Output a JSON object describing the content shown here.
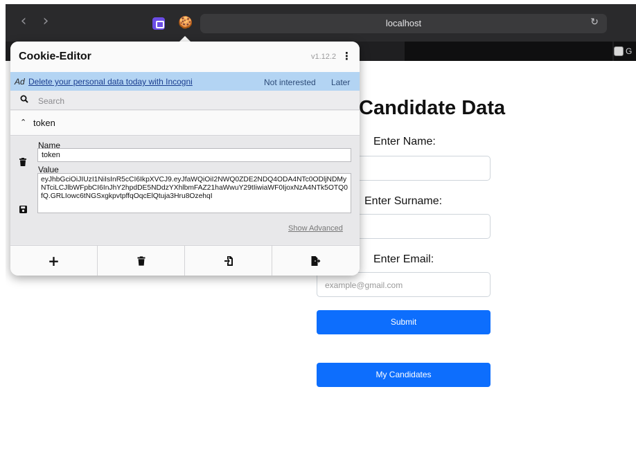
{
  "browser": {
    "url": "localhost",
    "tab_right_label": "G"
  },
  "page": {
    "title": "Candidate Data",
    "name_label": "Enter Name:",
    "surname_label": "Enter Surname:",
    "email_label": "Enter Email:",
    "email_placeholder": "example@gmail.com",
    "submit_label": "Submit",
    "my_candidates_label": "My Candidates"
  },
  "popup": {
    "title": "Cookie-Editor",
    "version": "v1.12.2",
    "ad": {
      "tag": "Ad",
      "link": "Delete your personal data today with Incogni",
      "not_interested": "Not interested",
      "later": "Later"
    },
    "search_placeholder": "Search",
    "cookie_name": "token",
    "details": {
      "name_label": "Name",
      "name_value": "token",
      "value_label": "Value",
      "value": "eyJhbGciOiJIUzI1NiIsInR5cCI6IkpXVCJ9.eyJfaWQiOiI2NWQ0ZDE2NDQ4ODA4NTc0ODljNDMyNTciLCJlbWFpbCI6InJhY2hpdDE5NDdzYXhlbmFAZ21haWwuY29tIiwiaWF0IjoxNzA4NTk5OTQ0fQ.GRLIowc6tNGSxgkpvtpffqOqcElQtuja3Hru8OzehqI",
      "show_advanced": "Show Advanced"
    }
  },
  "colors": {
    "accent": "#0d6efd",
    "ad_banner": "#b3d4f3"
  }
}
